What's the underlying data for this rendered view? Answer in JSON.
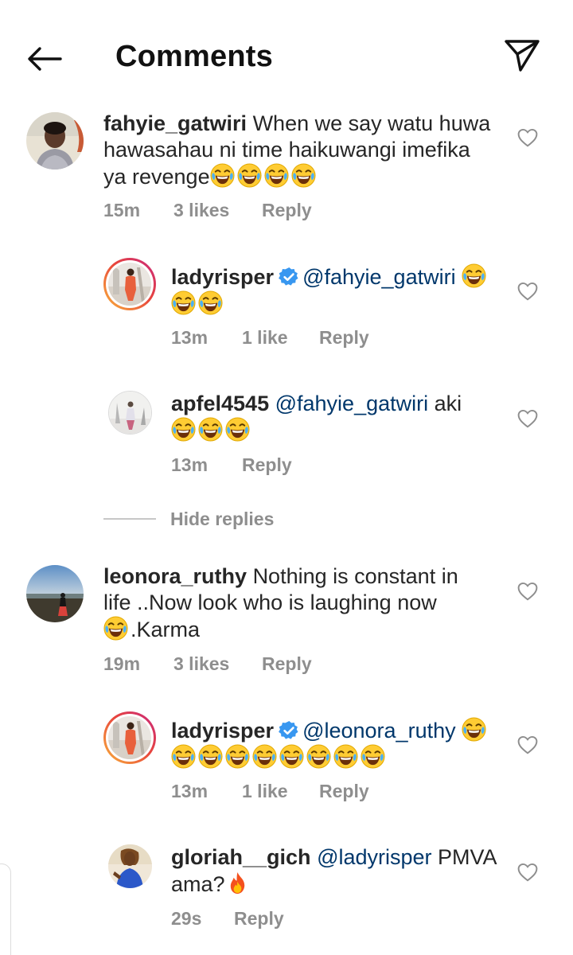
{
  "header": {
    "title": "Comments"
  },
  "icons": {
    "back": "arrow-left-icon",
    "send": "paper-plane-icon",
    "like": "heart-outline-icon",
    "verified": "verified-badge-icon",
    "emoji": "face-with-tears-of-joy",
    "fire": "fire-icon"
  },
  "colors": {
    "mention": "#00376b",
    "meta": "#8e8e8e",
    "verified": "#3897f0",
    "text": "#262626"
  },
  "comments": [
    {
      "username": "fahyie_gatwiri",
      "line1": "When we say watu huwa",
      "line2": "hawasahau ni time haikuwangi imefika",
      "line3": "ya revenge",
      "time": "15m",
      "likes": "3 likes",
      "reply": "Reply"
    },
    {
      "username": "ladyrisper",
      "mention": "@fahyie_gatwiri",
      "time": "13m",
      "likes": "1 like",
      "reply": "Reply"
    },
    {
      "username": "apfel4545",
      "mention": "@fahyie_gatwiri",
      "after": "aki",
      "time": "13m",
      "reply": "Reply"
    },
    {
      "username": "leonora_ruthy",
      "line1": "Nothing is constant in",
      "line2": "life ..Now look who is laughing now",
      "line3": ".Karma",
      "time": "19m",
      "likes": "3 likes",
      "reply": "Reply"
    },
    {
      "username": "ladyrisper",
      "mention": "@leonora_ruthy",
      "time": "13m",
      "likes": "1 like",
      "reply": "Reply"
    },
    {
      "username": "gloriah__gich",
      "mention": "@ladyrisper",
      "after": "PMVA",
      "line2": "ama?",
      "time": "29s",
      "reply": "Reply"
    }
  ],
  "hide_replies": "Hide replies"
}
